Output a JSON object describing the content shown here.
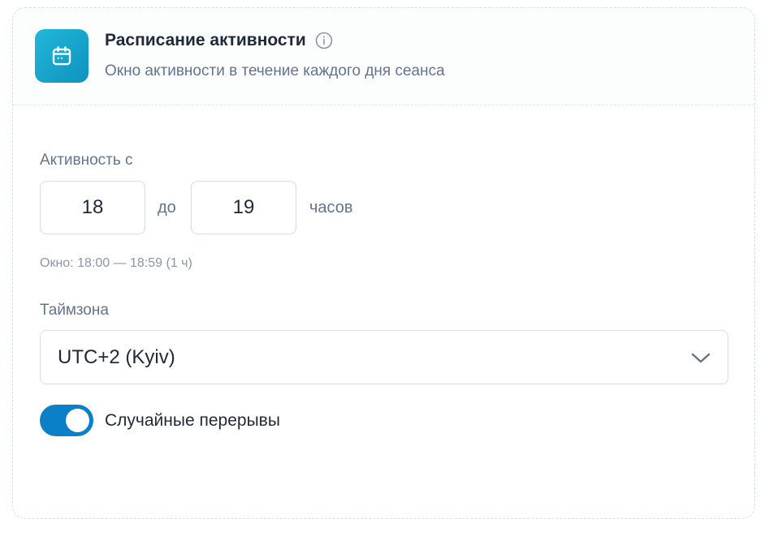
{
  "header": {
    "title": "Расписание активности",
    "subtitle": "Окно активности в течение каждого дня сеанса",
    "icon": "calendar-icon",
    "info_icon": "info-icon"
  },
  "activity": {
    "label": "Активность с",
    "from_value": "18",
    "to_word": "до",
    "to_value": "19",
    "unit": "часов",
    "window_hint": "Окно: 18:00 — 18:59 (1 ч)"
  },
  "timezone": {
    "label": "Таймзона",
    "selected": "UTC+2 (Kyiv)",
    "icon": "chevron-down-icon"
  },
  "random_breaks": {
    "label": "Случайные перерывы",
    "enabled": true
  },
  "colors": {
    "accent": "#0c7fc9",
    "icon_tile_start": "#22b8d8",
    "icon_tile_end": "#0e92bf",
    "muted_text": "#64748b",
    "border": "#d7dde3"
  }
}
